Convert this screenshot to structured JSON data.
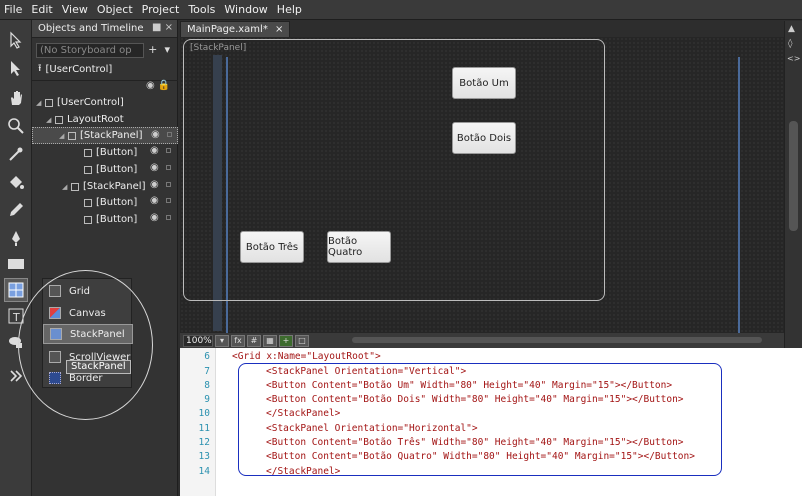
{
  "menu": [
    "File",
    "Edit",
    "View",
    "Object",
    "Project",
    "Tools",
    "Window",
    "Help"
  ],
  "objects_panel": {
    "title": "Objects and Timeline",
    "storyboard_placeholder": "(No Storyboard op",
    "root_label": "[UserControl]",
    "tree": [
      {
        "label": "[UserControl]",
        "indent": 0
      },
      {
        "label": "LayoutRoot",
        "indent": 1
      },
      {
        "label": "[StackPanel]",
        "indent": 2,
        "selected": true
      },
      {
        "label": "[Button]",
        "indent": 3
      },
      {
        "label": "[Button]",
        "indent": 3
      },
      {
        "label": "[StackPanel]",
        "indent": 2
      },
      {
        "label": "[Button]",
        "indent": 3
      },
      {
        "label": "[Button]",
        "indent": 3
      }
    ]
  },
  "flyout": {
    "items": [
      "Grid",
      "Canvas",
      "StackPanel",
      "ScrollViewer",
      "Border"
    ],
    "highlighted": "StackPanel",
    "tooltip": "StackPanel"
  },
  "document": {
    "tab_label": "MainPage.xaml*",
    "frame_label": "[StackPanel]",
    "buttons": [
      "Botão Um",
      "Botão Dois",
      "Botão Três",
      "Botão Quatro"
    ],
    "zoom": "100%"
  },
  "xaml": {
    "line_numbers": [
      "6",
      "7",
      "8",
      "9",
      "10",
      "11",
      "12",
      "13",
      "14"
    ],
    "lines": [
      "<Grid x:Name=\"LayoutRoot\">",
      "<StackPanel Orientation=\"Vertical\">",
      "<Button Content=\"Botão Um\" Width=\"80\" Height=\"40\" Margin=\"15\"></Button>",
      "<Button Content=\"Botão Dois\" Width=\"80\" Height=\"40\" Margin=\"15\"></Button>",
      "</StackPanel>",
      "<StackPanel Orientation=\"Horizontal\">",
      "<Button Content=\"Botão Três\" Width=\"80\" Height=\"40\" Margin=\"15\"></Button>",
      "<Button Content=\"Botão Quatro\" Width=\"80\" Height=\"40\" Margin=\"15\"></Button>",
      "</StackPanel>"
    ]
  }
}
